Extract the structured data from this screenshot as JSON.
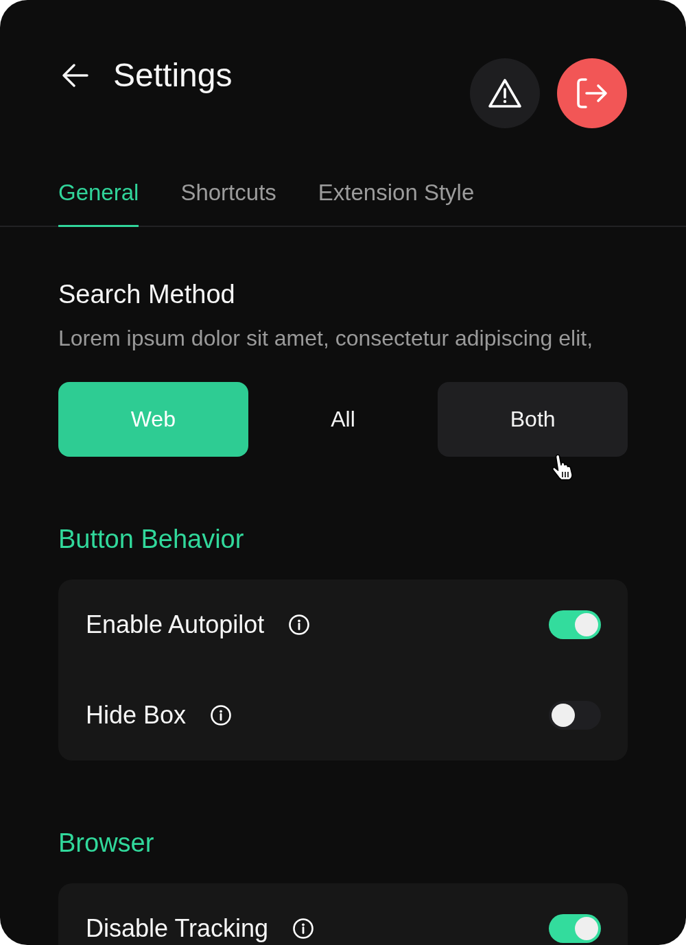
{
  "header": {
    "title": "Settings"
  },
  "tabs": [
    {
      "label": "General",
      "selected": true
    },
    {
      "label": "Shortcuts",
      "selected": false
    },
    {
      "label": "Extension Style",
      "selected": false
    }
  ],
  "search_method": {
    "title": "Search Method",
    "description": "Lorem ipsum dolor sit amet, consectetur adipiscing elit,",
    "options": [
      {
        "label": "Web",
        "selected": true,
        "hovered": false
      },
      {
        "label": "All",
        "selected": false,
        "hovered": false
      },
      {
        "label": "Both",
        "selected": false,
        "hovered": true
      }
    ]
  },
  "sections": [
    {
      "title": "Button Behavior",
      "settings": [
        {
          "label": "Enable Autopilot",
          "on": true
        },
        {
          "label": "Hide Box",
          "on": false
        }
      ]
    },
    {
      "title": "Browser",
      "settings": [
        {
          "label": "Disable Tracking",
          "on": true
        }
      ]
    }
  ]
}
